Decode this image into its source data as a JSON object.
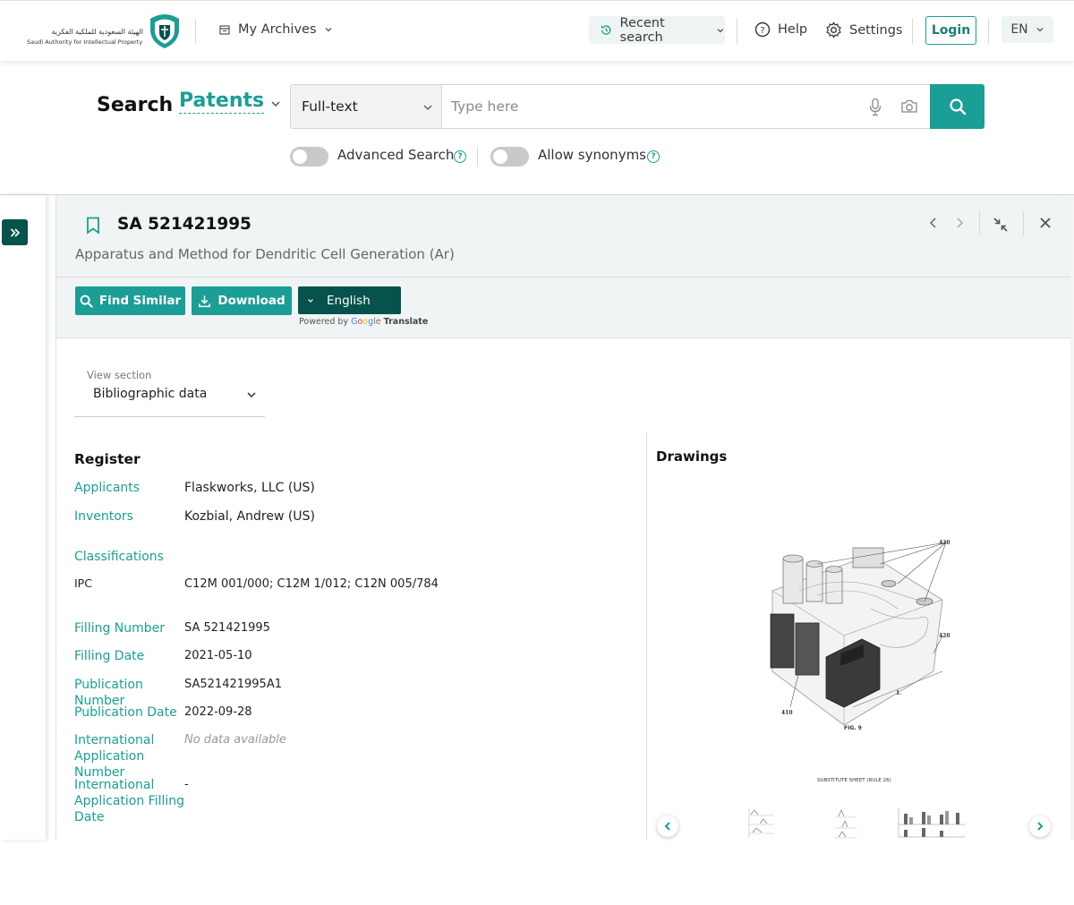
{
  "header": {
    "logo_ar": "الهيئة السعودية للملكية الفكرية",
    "logo_en": "Saudi Authority for Intellectual Property",
    "archives": "My Archives",
    "recent_search": "Recent search",
    "help": "Help",
    "settings": "Settings",
    "login": "Login",
    "language": "EN"
  },
  "search": {
    "label": "Search",
    "category": "Patents",
    "mode": "Full-text",
    "placeholder": "Type here",
    "advanced": "Advanced Search",
    "synonyms": "Allow synonyms",
    "advanced_on": false,
    "synonyms_on": false
  },
  "document": {
    "number": "SA 521421995",
    "title": "Apparatus and Method for Dendritic Cell Generation (Ar)",
    "find_similar": "Find Similar",
    "download": "Download",
    "translate_lang": "English",
    "powered_by": "Powered by",
    "translate": "Translate"
  },
  "view_section": {
    "label": "View section",
    "value": "Bibliographic data"
  },
  "register": {
    "heading": "Register",
    "applicants_label": "Applicants",
    "applicants": "Flaskworks, LLC (US)",
    "inventors_label": "Inventors",
    "inventors": "Kozbial, Andrew (US)",
    "classifications_label": "Classifications",
    "ipc_label": "IPC",
    "ipc": "C12M 001/000; C12M 1/012; C12N 005/784",
    "filling_number_label": "Filling Number",
    "filling_number": "SA 521421995",
    "filling_date_label": "Filling Date",
    "filling_date": "2021-05-10",
    "publication_number_label": "Publication Number",
    "publication_number": "SA521421995A1",
    "publication_date_label": "Publication Date",
    "publication_date": "2022-09-28",
    "intl_app_number_label_1": "International",
    "intl_app_number_label_2": "Application Number",
    "intl_app_number": "No data available",
    "intl_filling_label_1": "International",
    "intl_filling_label_2": "Application Filling",
    "intl_filling_label_3": "Date",
    "intl_filling_date": "-"
  },
  "drawings": {
    "heading": "Drawings",
    "fig_label": "FIG. 9",
    "sheet_label": "SUBSTITUTE SHEET (RULE 26)",
    "ref_430": "430",
    "ref_420": "420",
    "ref_410": "410",
    "ref_l": "1."
  },
  "colors": {
    "accent": "#1a9e95",
    "dark_accent": "#06524c"
  }
}
